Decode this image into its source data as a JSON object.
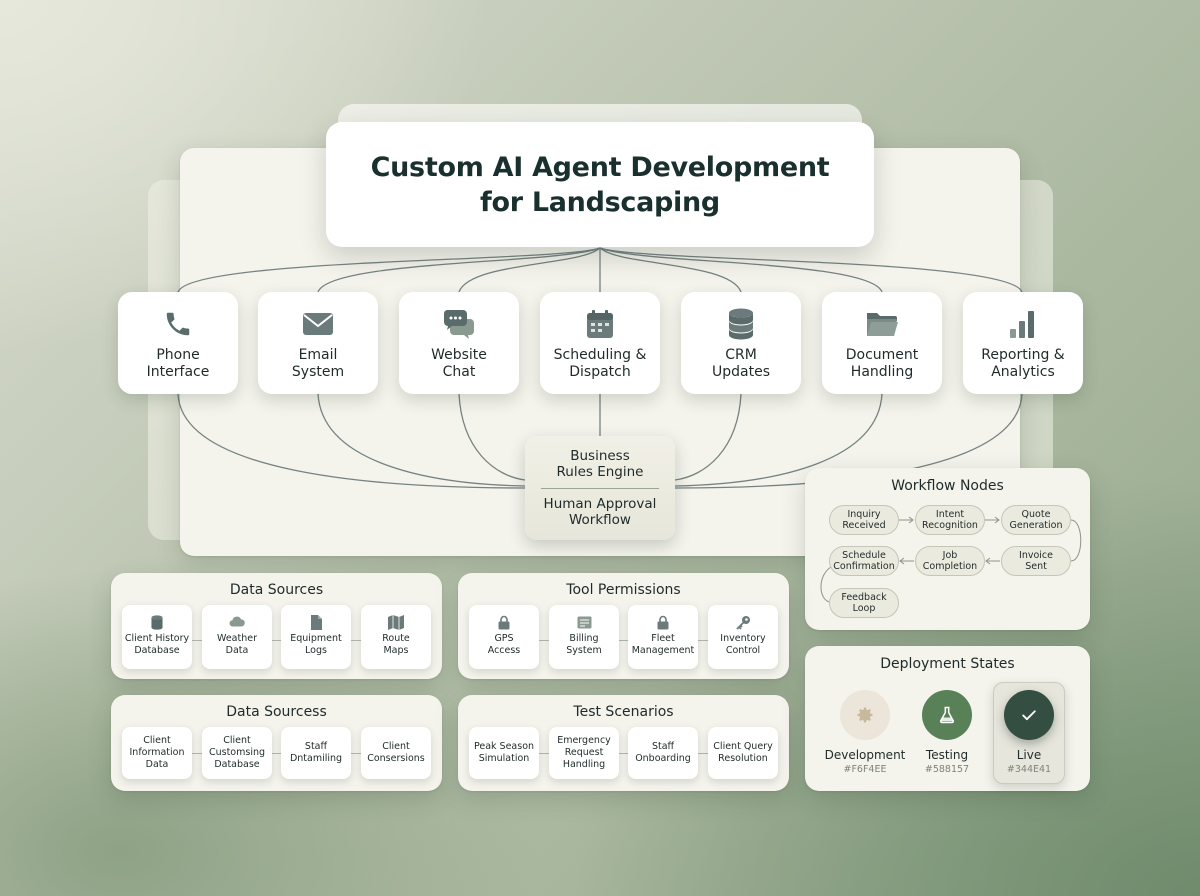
{
  "title": {
    "line1": "Custom AI Agent Development",
    "line2": "for Landscaping"
  },
  "channels": [
    {
      "label": "Phone\nInterface",
      "icon": "phone-icon"
    },
    {
      "label": "Email\nSystem",
      "icon": "envelope-icon"
    },
    {
      "label": "Website\nChat",
      "icon": "chat-bubbles-icon"
    },
    {
      "label": "Scheduling &\nDispatch",
      "icon": "calendar-icon"
    },
    {
      "label": "CRM\nUpdates",
      "icon": "database-icon"
    },
    {
      "label": "Document\nHandling",
      "icon": "folder-icon"
    },
    {
      "label": "Reporting &\nAnalytics",
      "icon": "bar-chart-icon"
    }
  ],
  "engine": {
    "rules": "Business\nRules Engine",
    "approval": "Human Approval\nWorkflow"
  },
  "workflow": {
    "title": "Workflow Nodes",
    "nodes": [
      "Inquiry\nReceived",
      "Intent\nRecognition",
      "Quote\nGeneration",
      "Invoice\nSent",
      "Job\nCompletion",
      "Schedule\nConfirmation",
      "Feedback\nLoop"
    ]
  },
  "data_sources": {
    "title": "Data Sources",
    "items": [
      {
        "label": "Client History\nDatabase",
        "icon": "database-icon"
      },
      {
        "label": "Weather\nData",
        "icon": "cloud-icon"
      },
      {
        "label": "Equipment\nLogs",
        "icon": "document-icon"
      },
      {
        "label": "Route\nMaps",
        "icon": "map-icon"
      }
    ]
  },
  "tool_permissions": {
    "title": "Tool Permissions",
    "items": [
      {
        "label": "GPS\nAccess",
        "icon": "lock-icon"
      },
      {
        "label": "Billing\nSystem",
        "icon": "invoice-icon"
      },
      {
        "label": "Fleet\nManagement",
        "icon": "lock-icon"
      },
      {
        "label": "Inventory\nControl",
        "icon": "key-icon"
      }
    ]
  },
  "data_sourcess": {
    "title": "Data Sourcess",
    "items": [
      "Client\nInformation\nData",
      "Client\nCustomsing\nDatabase",
      "Staff\nDntamiling",
      "Client\nConsersions"
    ]
  },
  "test_scenarios": {
    "title": "Test Scenarios",
    "items": [
      "Peak Season\nSimulation",
      "Emergency\nRequest\nHandling",
      "Staff\nOnboarding",
      "Client Query\nResolution"
    ]
  },
  "deployment": {
    "title": "Deployment States",
    "states": [
      {
        "name": "Development",
        "hex": "#F6F4EE",
        "icon": "gear-icon"
      },
      {
        "name": "Testing",
        "hex": "#588157",
        "icon": "flask-icon"
      },
      {
        "name": "Live",
        "hex": "#344E41",
        "icon": "check-icon"
      }
    ]
  }
}
